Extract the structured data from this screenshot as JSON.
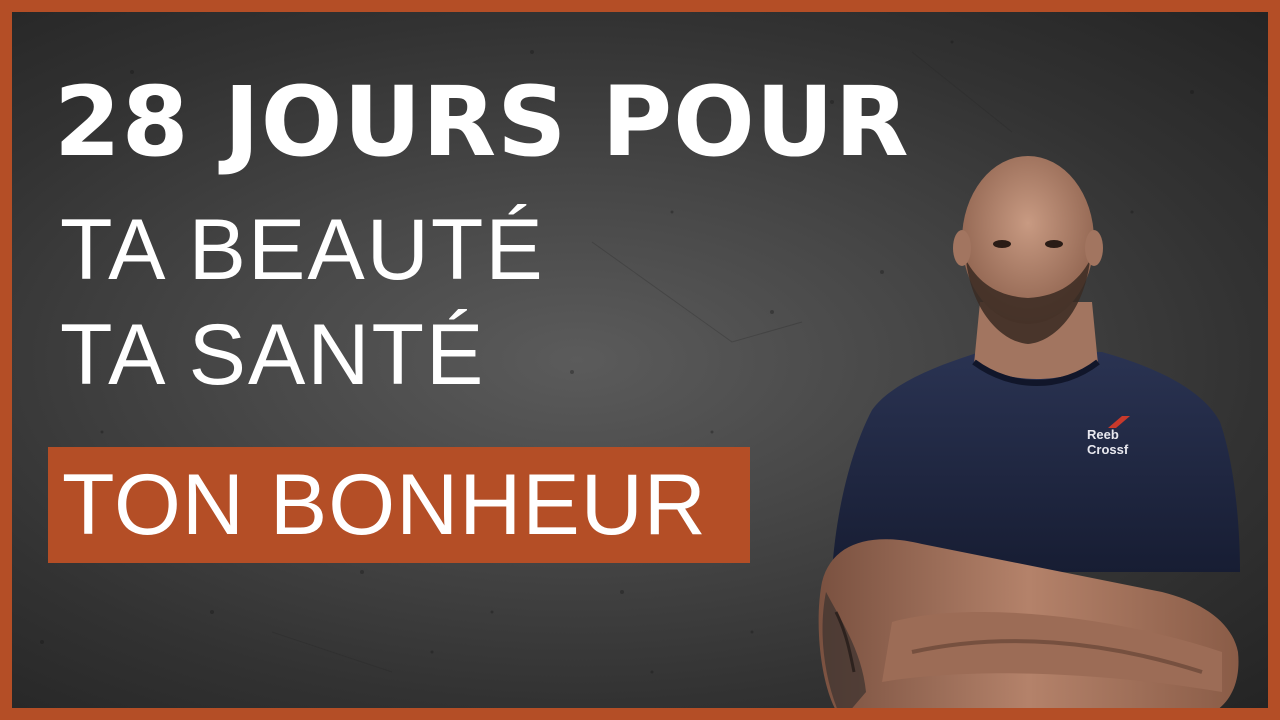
{
  "thumbnail": {
    "headline": "28 JOURS POUR",
    "line2": "TA BEAUTÉ",
    "line3": "TA SANTÉ",
    "banner": "TON BONHEUR",
    "shirt_logo_line1": "Reeb",
    "shirt_logo_line2": "Crossf"
  },
  "colors": {
    "accent": "#b44e26",
    "background": "#3c3c3c",
    "text": "#ffffff",
    "shirt": "#1d2540"
  },
  "icons": {
    "person": "man-arms-crossed-photo"
  }
}
